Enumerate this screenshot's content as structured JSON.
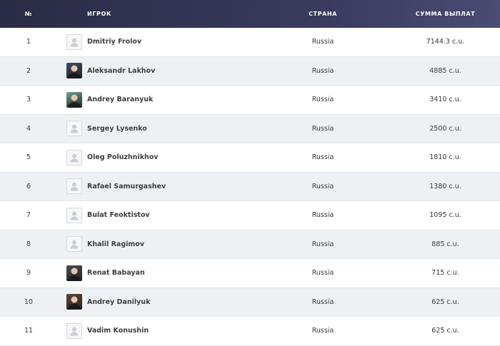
{
  "headers": {
    "num": "№",
    "player": "ИГРОК",
    "country": "СТРАНА",
    "payout": "СУММА ВЫПЛАТ"
  },
  "rows": [
    {
      "num": "1",
      "name": "Dmitriy Frolov",
      "country": "Russia",
      "payout": "7144.3 c.u.",
      "avatar": "placeholder"
    },
    {
      "num": "2",
      "name": "Aleksandr Lakhov",
      "country": "Russia",
      "payout": "4885 c.u.",
      "avatar": "photo",
      "color": "#3c4a6b"
    },
    {
      "num": "3",
      "name": "Andrey Baranyuk",
      "country": "Russia",
      "payout": "3410 c.u.",
      "avatar": "photo",
      "color": "#6fa38f"
    },
    {
      "num": "4",
      "name": "Sergey Lysenko",
      "country": "Russia",
      "payout": "2500 c.u.",
      "avatar": "placeholder"
    },
    {
      "num": "5",
      "name": "Oleg Poluzhnikhov",
      "country": "Russia",
      "payout": "1810 c.u.",
      "avatar": "placeholder"
    },
    {
      "num": "6",
      "name": "Rafael Samurgashev",
      "country": "Russia",
      "payout": "1380 c.u.",
      "avatar": "placeholder"
    },
    {
      "num": "7",
      "name": "Bulat Feoktistov",
      "country": "Russia",
      "payout": "1095 c.u.",
      "avatar": "placeholder"
    },
    {
      "num": "8",
      "name": "Khalil Ragimov",
      "country": "Russia",
      "payout": "885 c.u.",
      "avatar": "placeholder"
    },
    {
      "num": "9",
      "name": "Renat Babayan",
      "country": "Russia",
      "payout": "715 c.u.",
      "avatar": "photo",
      "color": "#4a4f57"
    },
    {
      "num": "10",
      "name": "Andrey Danilyuk",
      "country": "Russia",
      "payout": "625 c.u.",
      "avatar": "photo",
      "color": "#5b4534"
    },
    {
      "num": "11",
      "name": "Vadim Konushin",
      "country": "Russia",
      "payout": "625 c.u.",
      "avatar": "placeholder"
    }
  ]
}
